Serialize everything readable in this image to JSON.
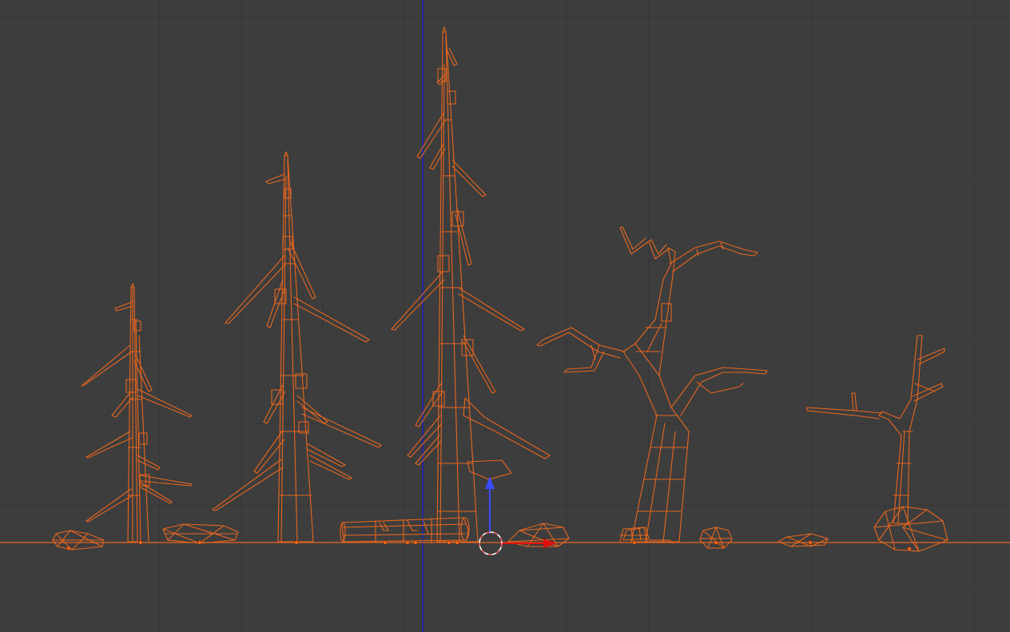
{
  "viewport": {
    "view": "front-orthographic",
    "shading": "wireframe",
    "colors": {
      "background": "#3d3d3d",
      "grid": "#353535",
      "selection": "#e8661e",
      "z_axis": "#1a1acc",
      "x_axis": "#ff2020",
      "gizmo_z": "#3b4dff",
      "gizmo_x": "#e01010",
      "cursor": "#ffffff"
    }
  },
  "scene": {
    "objects": [
      {
        "name": "pine-tree-small",
        "type": "tree",
        "selected": true
      },
      {
        "name": "pine-tree-medium",
        "type": "tree",
        "selected": true
      },
      {
        "name": "pine-tree-large",
        "type": "tree",
        "selected": true
      },
      {
        "name": "dead-tree-large",
        "type": "tree",
        "selected": true
      },
      {
        "name": "dead-tree-small",
        "type": "tree",
        "selected": true
      },
      {
        "name": "rock-1",
        "type": "rock",
        "selected": true
      },
      {
        "name": "rock-2",
        "type": "rock",
        "selected": true
      },
      {
        "name": "fallen-log",
        "type": "log",
        "selected": true
      },
      {
        "name": "rock-3",
        "type": "rock",
        "selected": true
      },
      {
        "name": "stump",
        "type": "stump",
        "selected": true
      },
      {
        "name": "rock-4",
        "type": "rock",
        "selected": true
      },
      {
        "name": "rock-5",
        "type": "rock",
        "selected": true
      },
      {
        "name": "rock-pile",
        "type": "rock",
        "selected": true
      }
    ]
  },
  "icons": {
    "cursor": "3d-cursor-icon",
    "gizmo": "transform-gizmo-icon"
  }
}
